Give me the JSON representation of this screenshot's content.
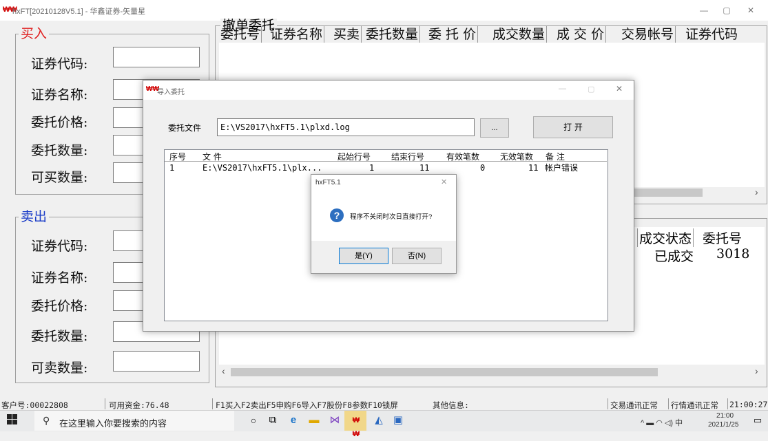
{
  "window": {
    "logo": "₩₩",
    "title": "hxFT[20210128V5.1] - 华鑫证券-矢量星",
    "minimize": "—",
    "maximize": "▢",
    "close": "✕"
  },
  "buy": {
    "title": "买入",
    "labels": [
      "证券代码:",
      "证券名称:",
      "委托价格:",
      "委托数量:",
      "可买数量:"
    ]
  },
  "sell": {
    "title": "卖出",
    "labels": [
      "证券代码:",
      "证券名称:",
      "委托价格:",
      "委托数量:",
      "可卖数量:"
    ]
  },
  "cancel": {
    "title": "撤单委托",
    "headers": [
      "委托号",
      "证券名称",
      "买卖",
      "委托数量",
      "委 托 价",
      "成交数量",
      "成 交 价",
      "交易帐号",
      "证券代码"
    ],
    "scroll_right": "›",
    "scroll_left": "‹"
  },
  "orders": {
    "headers": [
      "成交状态",
      "委托号"
    ],
    "row": {
      "status": "已成交",
      "id": "3018"
    }
  },
  "status": {
    "account": "客户号:00022808",
    "funds": "可用资金:76.48",
    "shortcuts": "F1买入F2卖出F5申购F6导入F7股份F8参数F10锁屏",
    "other": "其他信息:",
    "trade_conn": "交易通讯正常",
    "quote_conn": "行情通讯正常",
    "time": "21:00:27"
  },
  "import_dialog": {
    "logo": "₩₩",
    "title": "导入委托",
    "file_label": "委托文件",
    "file_path": "E:\\VS2017\\hxFT5.1\\plxd.log",
    "browse": "...",
    "open": "打  开",
    "columns": [
      "序号",
      "文  件",
      "起始行号",
      "结束行号",
      "有效笔数",
      "无效笔数",
      "备  注"
    ],
    "rows": [
      {
        "no": "1",
        "file": "E:\\VS2017\\hxFT5.1\\plx...",
        "start": "1",
        "end": "11",
        "valid": "0",
        "invalid": "11",
        "note": "帐户错误"
      }
    ]
  },
  "msgbox": {
    "title": "hxFT5.1",
    "text": "程序不关闭时次日直接打开?",
    "yes": "是(Y)",
    "no": "否(N)",
    "icon": "?",
    "close": "✕"
  },
  "taskbar": {
    "search_placeholder": "在这里输入你要搜索的内容",
    "tray": "^ ▬ ◠ ◁) 中",
    "time": "21:00",
    "date": "2021/1/25"
  }
}
